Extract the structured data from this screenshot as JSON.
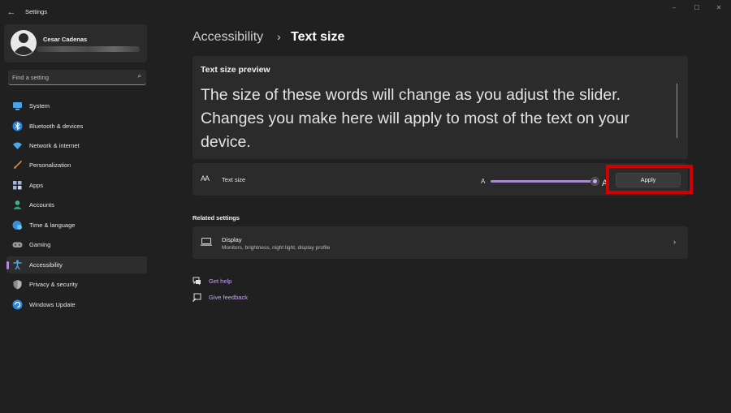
{
  "window": {
    "title": "Settings",
    "back_icon": "back-arrow-icon"
  },
  "controls": {
    "minimize": "–",
    "maximize": "☐",
    "close": "✕"
  },
  "profile": {
    "name": "Cesar Cadenas"
  },
  "search": {
    "placeholder": "Find a setting",
    "icon": "search-icon"
  },
  "sidebar": {
    "items": [
      {
        "label": "System",
        "icon": "monitor-icon",
        "active": false
      },
      {
        "label": "Bluetooth & devices",
        "icon": "bluetooth-icon",
        "active": false
      },
      {
        "label": "Network & internet",
        "icon": "wifi-icon",
        "active": false
      },
      {
        "label": "Personalization",
        "icon": "brush-icon",
        "active": false
      },
      {
        "label": "Apps",
        "icon": "apps-icon",
        "active": false
      },
      {
        "label": "Accounts",
        "icon": "account-icon",
        "active": false
      },
      {
        "label": "Time & language",
        "icon": "globe-clock-icon",
        "active": false
      },
      {
        "label": "Gaming",
        "icon": "gamepad-icon",
        "active": false
      },
      {
        "label": "Accessibility",
        "icon": "accessibility-icon",
        "active": true
      },
      {
        "label": "Privacy & security",
        "icon": "shield-icon",
        "active": false
      },
      {
        "label": "Windows Update",
        "icon": "update-icon",
        "active": false
      }
    ]
  },
  "breadcrumb": {
    "parent": "Accessibility",
    "separator": "›",
    "current": "Text size"
  },
  "preview": {
    "title": "Text size preview",
    "text": "The size of these words will change as you adjust the slider. Changes you make here will apply to most of the text on your device."
  },
  "text_size": {
    "icon_glyph": "AA",
    "label": "Text size",
    "slider_min_label": "A",
    "slider_max_label": "A",
    "slider_value_fraction": 1.0,
    "apply_label": "Apply"
  },
  "related": {
    "heading": "Related settings",
    "display": {
      "title": "Display",
      "subtitle": "Monitors, brightness, night light, display profile",
      "chevron": "›"
    }
  },
  "links": {
    "get_help": "Get help",
    "give_feedback": "Give feedback"
  },
  "colors": {
    "accent": "#b288e0",
    "highlight": "#d00000",
    "background": "#202020",
    "card": "#2b2b2b"
  }
}
